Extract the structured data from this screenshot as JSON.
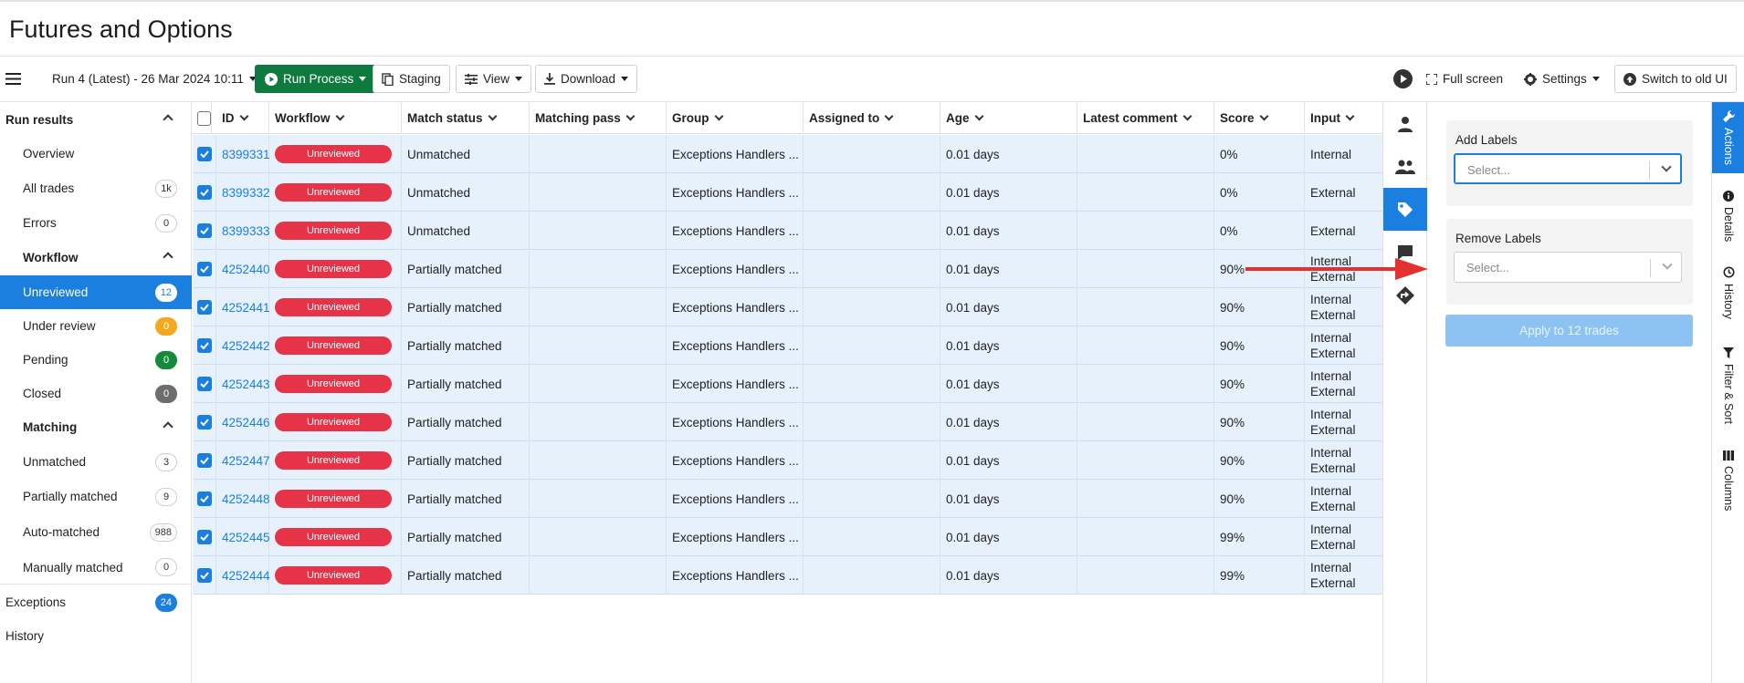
{
  "page": {
    "title": "Futures and Options"
  },
  "toolbar": {
    "run_selector": "Run 4 (Latest) - 26 Mar 2024 10:11",
    "run_process": "Run Process",
    "staging": "Staging",
    "view": "View",
    "download": "Download",
    "full_screen": "Full screen",
    "settings": "Settings",
    "switch_ui": "Switch to old UI"
  },
  "sidebar": {
    "run_results": "Run results",
    "overview": "Overview",
    "all_trades": {
      "label": "All trades",
      "count": "1k"
    },
    "errors": {
      "label": "Errors",
      "count": "0"
    },
    "workflow_header": "Workflow",
    "workflow": [
      {
        "label": "Unreviewed",
        "count": "12"
      },
      {
        "label": "Under review",
        "count": "0"
      },
      {
        "label": "Pending",
        "count": "0"
      },
      {
        "label": "Closed",
        "count": "0"
      }
    ],
    "matching_header": "Matching",
    "matching": [
      {
        "label": "Unmatched",
        "count": "3"
      },
      {
        "label": "Partially matched",
        "count": "9"
      },
      {
        "label": "Auto-matched",
        "count": "988"
      },
      {
        "label": "Manually matched",
        "count": "0"
      }
    ],
    "exceptions": {
      "label": "Exceptions",
      "count": "24"
    },
    "history": "History"
  },
  "grid": {
    "columns": [
      "ID",
      "Workflow",
      "Match status",
      "Matching pass",
      "Group",
      "Assigned to",
      "Age",
      "Latest comment",
      "Score",
      "Input"
    ],
    "rows": [
      {
        "id": "8399331",
        "workflow": "Unreviewed",
        "match_status": "Unmatched",
        "group": "Exceptions Handlers ...",
        "age": "0.01 days",
        "score": "0%",
        "input": [
          "Internal"
        ]
      },
      {
        "id": "8399332",
        "workflow": "Unreviewed",
        "match_status": "Unmatched",
        "group": "Exceptions Handlers ...",
        "age": "0.01 days",
        "score": "0%",
        "input": [
          "External"
        ]
      },
      {
        "id": "8399333",
        "workflow": "Unreviewed",
        "match_status": "Unmatched",
        "group": "Exceptions Handlers ...",
        "age": "0.01 days",
        "score": "0%",
        "input": [
          "External"
        ]
      },
      {
        "id": "4252440",
        "workflow": "Unreviewed",
        "match_status": "Partially matched",
        "group": "Exceptions Handlers ...",
        "age": "0.01 days",
        "score": "90%",
        "input": [
          "Internal",
          "External"
        ]
      },
      {
        "id": "4252441",
        "workflow": "Unreviewed",
        "match_status": "Partially matched",
        "group": "Exceptions Handlers ...",
        "age": "0.01 days",
        "score": "90%",
        "input": [
          "Internal",
          "External"
        ]
      },
      {
        "id": "4252442",
        "workflow": "Unreviewed",
        "match_status": "Partially matched",
        "group": "Exceptions Handlers ...",
        "age": "0.01 days",
        "score": "90%",
        "input": [
          "Internal",
          "External"
        ]
      },
      {
        "id": "4252443",
        "workflow": "Unreviewed",
        "match_status": "Partially matched",
        "group": "Exceptions Handlers ...",
        "age": "0.01 days",
        "score": "90%",
        "input": [
          "Internal",
          "External"
        ]
      },
      {
        "id": "4252446",
        "workflow": "Unreviewed",
        "match_status": "Partially matched",
        "group": "Exceptions Handlers ...",
        "age": "0.01 days",
        "score": "90%",
        "input": [
          "Internal",
          "External"
        ]
      },
      {
        "id": "4252447",
        "workflow": "Unreviewed",
        "match_status": "Partially matched",
        "group": "Exceptions Handlers ...",
        "age": "0.01 days",
        "score": "90%",
        "input": [
          "Internal",
          "External"
        ]
      },
      {
        "id": "4252448",
        "workflow": "Unreviewed",
        "match_status": "Partially matched",
        "group": "Exceptions Handlers ...",
        "age": "0.01 days",
        "score": "90%",
        "input": [
          "Internal",
          "External"
        ]
      },
      {
        "id": "4252445",
        "workflow": "Unreviewed",
        "match_status": "Partially matched",
        "group": "Exceptions Handlers ...",
        "age": "0.01 days",
        "score": "99%",
        "input": [
          "Internal",
          "External"
        ]
      },
      {
        "id": "4252444",
        "workflow": "Unreviewed",
        "match_status": "Partially matched",
        "group": "Exceptions Handlers ...",
        "age": "0.01 days",
        "score": "99%",
        "input": [
          "Internal",
          "External"
        ]
      }
    ]
  },
  "icon_rail": [
    "person-icon",
    "group-icon",
    "tag-icon",
    "comment-icon",
    "route-icon"
  ],
  "panel": {
    "add_labels": "Add Labels",
    "add_placeholder": "Select...",
    "remove_labels": "Remove Labels",
    "remove_placeholder": "Select...",
    "apply": "Apply to 12 trades"
  },
  "vertical_tabs": [
    "Actions",
    "Details",
    "History",
    "Filter & Sort",
    "Columns"
  ],
  "colors": {
    "accent": "#1b7fe0",
    "primary_green": "#0f7a3e",
    "unreviewed_red": "#e63347",
    "row_selected": "#e6f1fc",
    "annotation_arrow": "#e53030"
  }
}
